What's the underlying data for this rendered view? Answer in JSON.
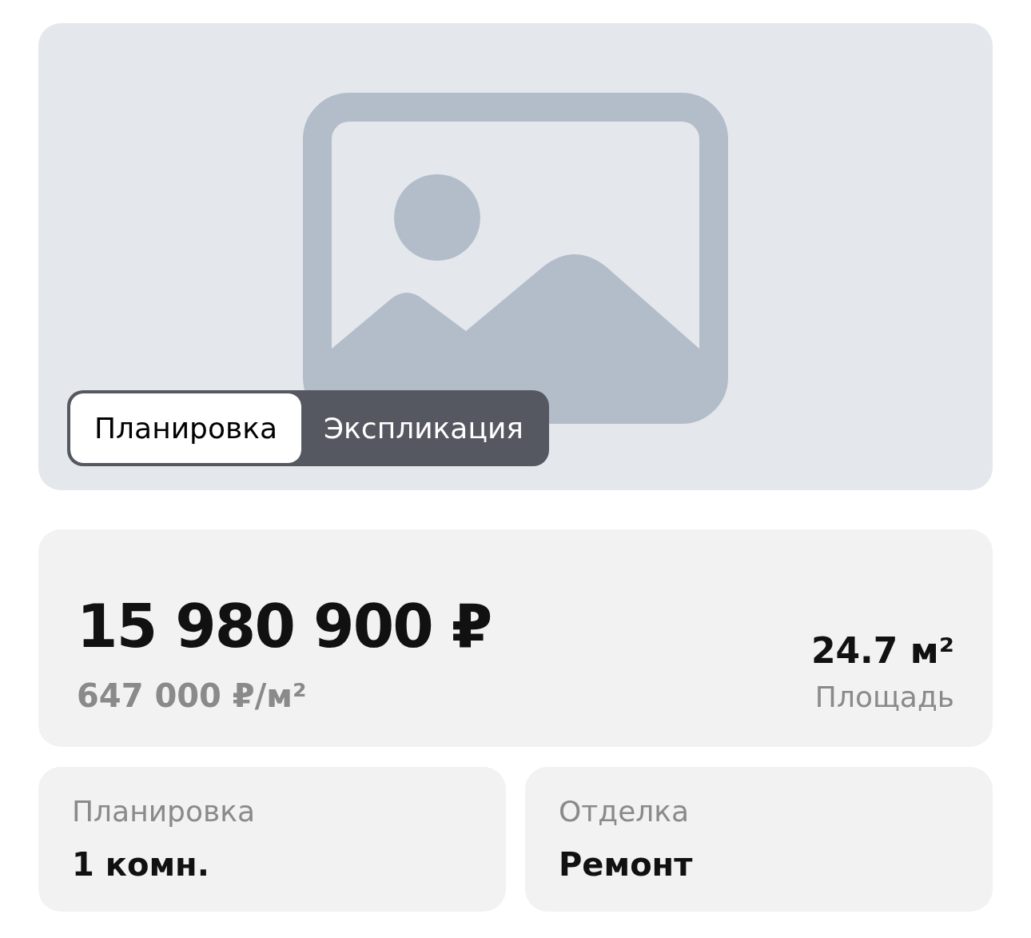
{
  "gallery": {
    "tabs": [
      {
        "label": "Планировка",
        "selected": true
      },
      {
        "label": "Экспликация",
        "selected": false
      }
    ]
  },
  "price": {
    "total": "15 980 900 ₽",
    "per_m2": "647 000 ₽/м²"
  },
  "area": {
    "value": "24.7 м²",
    "label": "Площадь"
  },
  "details": [
    {
      "label": "Планировка",
      "value": "1 комн."
    },
    {
      "label": "Отделка",
      "value": "Ремонт"
    }
  ]
}
